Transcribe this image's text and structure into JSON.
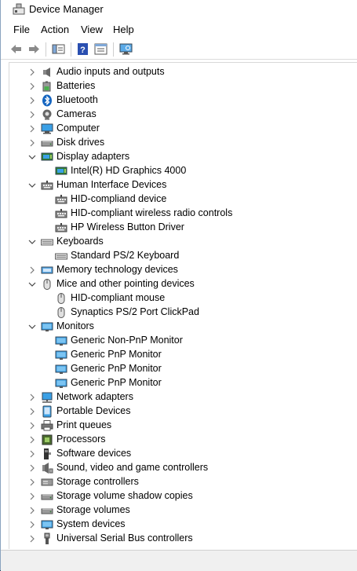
{
  "window": {
    "title": "Device Manager"
  },
  "menu": {
    "file": "File",
    "action": "Action",
    "view": "View",
    "help": "Help"
  },
  "colors": {
    "icon_blue": "#2a7bd6",
    "monitor_blue": "#3aa0e6",
    "gray": "#7a7a7a"
  },
  "tree": [
    {
      "label": "Audio inputs and outputs",
      "level": 0,
      "state": "collapsed",
      "icon": "speaker-icon"
    },
    {
      "label": "Batteries",
      "level": 0,
      "state": "collapsed",
      "icon": "battery-icon"
    },
    {
      "label": "Bluetooth",
      "level": 0,
      "state": "collapsed",
      "icon": "bluetooth-icon"
    },
    {
      "label": "Cameras",
      "level": 0,
      "state": "collapsed",
      "icon": "camera-icon"
    },
    {
      "label": "Computer",
      "level": 0,
      "state": "collapsed",
      "icon": "computer-icon"
    },
    {
      "label": "Disk drives",
      "level": 0,
      "state": "collapsed",
      "icon": "disk-icon"
    },
    {
      "label": "Display adapters",
      "level": 0,
      "state": "expanded",
      "icon": "display-adapter-icon"
    },
    {
      "label": "Intel(R) HD Graphics 4000",
      "level": 1,
      "state": "leaf",
      "icon": "display-adapter-icon"
    },
    {
      "label": "Human Interface Devices",
      "level": 0,
      "state": "expanded",
      "icon": "hid-icon"
    },
    {
      "label": "HID-compliand device",
      "level": 1,
      "state": "leaf",
      "icon": "hid-icon"
    },
    {
      "label": "HID-compliant wireless radio controls",
      "level": 1,
      "state": "leaf",
      "icon": "hid-icon"
    },
    {
      "label": "HP Wireless Button Driver",
      "level": 1,
      "state": "leaf",
      "icon": "hid-icon"
    },
    {
      "label": "Keyboards",
      "level": 0,
      "state": "expanded",
      "icon": "keyboard-icon"
    },
    {
      "label": "Standard PS/2 Keyboard",
      "level": 1,
      "state": "leaf",
      "icon": "keyboard-icon"
    },
    {
      "label": "Memory technology devices",
      "level": 0,
      "state": "collapsed",
      "icon": "memory-icon"
    },
    {
      "label": "Mice and other pointing devices",
      "level": 0,
      "state": "expanded",
      "icon": "mouse-icon"
    },
    {
      "label": "HID-compliant mouse",
      "level": 1,
      "state": "leaf",
      "icon": "mouse-icon"
    },
    {
      "label": "Synaptics PS/2 Port ClickPad",
      "level": 1,
      "state": "leaf",
      "icon": "mouse-icon"
    },
    {
      "label": "Monitors",
      "level": 0,
      "state": "expanded",
      "icon": "monitor-icon"
    },
    {
      "label": "Generic Non-PnP Monitor",
      "level": 1,
      "state": "leaf",
      "icon": "monitor-icon"
    },
    {
      "label": "Generic PnP Monitor",
      "level": 1,
      "state": "leaf",
      "icon": "monitor-icon"
    },
    {
      "label": "Generic PnP Monitor",
      "level": 1,
      "state": "leaf",
      "icon": "monitor-icon"
    },
    {
      "label": "Generic PnP Monitor",
      "level": 1,
      "state": "leaf",
      "icon": "monitor-icon"
    },
    {
      "label": "Network adapters",
      "level": 0,
      "state": "collapsed",
      "icon": "network-icon"
    },
    {
      "label": "Portable Devices",
      "level": 0,
      "state": "collapsed",
      "icon": "portable-device-icon"
    },
    {
      "label": "Print queues",
      "level": 0,
      "state": "collapsed",
      "icon": "printer-icon"
    },
    {
      "label": "Processors",
      "level": 0,
      "state": "collapsed",
      "icon": "processor-icon"
    },
    {
      "label": "Software devices",
      "level": 0,
      "state": "collapsed",
      "icon": "software-device-icon"
    },
    {
      "label": "Sound, video and game controllers",
      "level": 0,
      "state": "collapsed",
      "icon": "sound-icon"
    },
    {
      "label": "Storage controllers",
      "level": 0,
      "state": "collapsed",
      "icon": "storage-controller-icon"
    },
    {
      "label": "Storage volume shadow copies",
      "level": 0,
      "state": "collapsed",
      "icon": "disk-icon"
    },
    {
      "label": "Storage volumes",
      "level": 0,
      "state": "collapsed",
      "icon": "disk-icon"
    },
    {
      "label": "System devices",
      "level": 0,
      "state": "collapsed",
      "icon": "system-devices-icon"
    },
    {
      "label": "Universal Serial Bus controllers",
      "level": 0,
      "state": "collapsed",
      "icon": "usb-icon"
    }
  ]
}
